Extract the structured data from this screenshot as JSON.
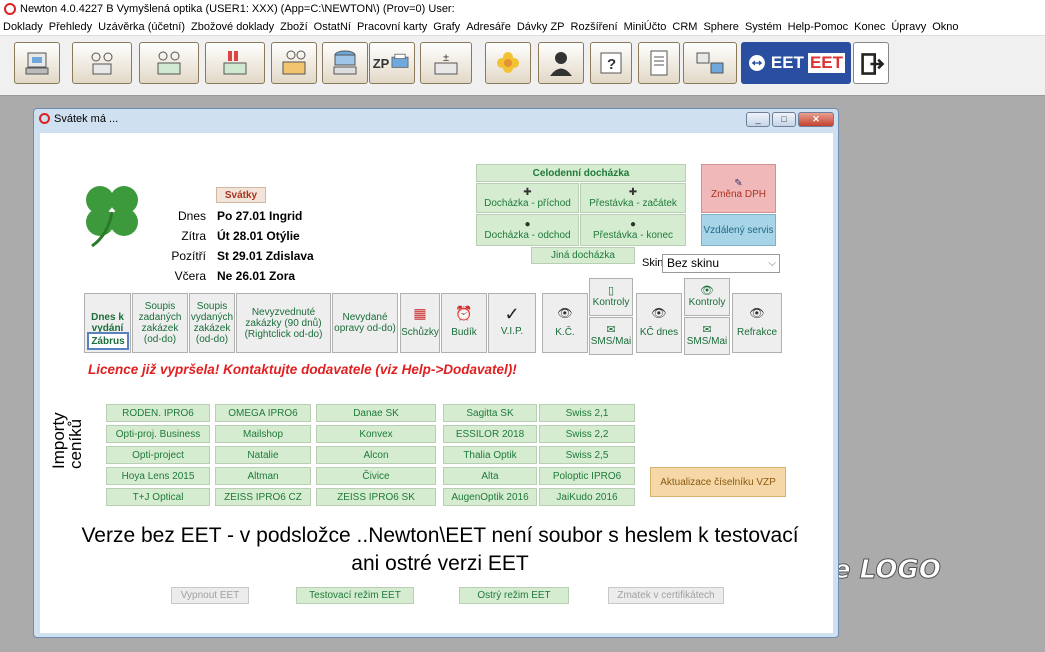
{
  "app": {
    "title": "Newton 4.0.4227 B Vymyšlená optika (USER1: XXX) (App=C:\\NEWTON\\) (Prov=0) User:"
  },
  "menu": [
    "Doklady",
    "Přehledy",
    "Uzávěrka (účetní)",
    "Zbožové doklady",
    "Zboží",
    "OstatNí",
    "Pracovní karty",
    "Grafy",
    "Adresáře",
    "Dávky ZP",
    "Rozšíření",
    "MiniÚčto",
    "CRM",
    "Sphere",
    "Systém",
    "Help-Pomoc",
    "Konec",
    "Úpravy",
    "Okno"
  ],
  "toolbar": {
    "zp_label": "ZP",
    "eet_label": "EET",
    "eet2_label": "EET"
  },
  "dialog": {
    "title": "Svátek má ...",
    "svatky_label": "Svátky",
    "rows": [
      {
        "label": "Dnes",
        "value": "Po 27.01 Ingrid"
      },
      {
        "label": "Zítra",
        "value": "Út 28.01 Otýlie"
      },
      {
        "label": "Pozítří",
        "value": "St 29.01 Zdislava"
      },
      {
        "label": "Včera",
        "value": "Ne 26.01 Zora"
      }
    ],
    "attendance": {
      "header": "Celodenní docházka",
      "prichod": "Docházka - příchod",
      "prestavka_zacatek": "Přestávka - začátek",
      "odchod": "Docházka - odchod",
      "prestavka_konec": "Přestávka - konec",
      "jina": "Jiná docházka"
    },
    "zmena_dph": "Změna DPH",
    "vzdaleny": "Vzdálený servis",
    "skin_label": "Skin",
    "skin_value": "Bez skinu",
    "tiles": {
      "dnes_k_vydani": "Dnes k vydání",
      "zabrus": "Zábrus",
      "soupis_zadanych": "Soupis zadaných zakázek (od-do)",
      "soupis_vydanych": "Soupis vydaných zakázek (od-do)",
      "nevyzvednute": "Nevyzvednuté zakázky (90 dnů) (Rightclick od-do)",
      "nevydane": "Nevydané opravy od-do)",
      "schuzky": "Schůzky",
      "budik": "Budík",
      "vip": "V.I.P.",
      "kc": "K.Č.",
      "kontroly1": "Kontroly",
      "sms1": "SMS/Mai",
      "kc_dnes": "KČ dnes",
      "kontroly2": "Kontroly",
      "sms2": "SMS/Mai",
      "refrakce": "Refrakce"
    },
    "licence_warning": "Licence již vypršela! Kontaktujte dodavatele (viz Help->Dodavatel)!",
    "imports_label": "Importy ceníků",
    "imports": [
      [
        "RODEN. IPRO6",
        "OMEGA IPRO6",
        "Danae SK",
        "Sagitta SK",
        "Swiss 2,1"
      ],
      [
        "Opti-proj. Business",
        "Mailshop",
        "Konvex",
        "ESSILOR 2018",
        "Swiss 2,2"
      ],
      [
        "Opti-project",
        "Natalie",
        "Alcon",
        "Thalia Optik",
        "Swiss 2,5"
      ],
      [
        "Hoya Lens 2015",
        "Altman",
        "Čivice",
        "Alta",
        "Poloptic IPRO6"
      ],
      [
        "T+J Optical",
        "ZEISS IPRO6 CZ",
        "ZEISS IPRO6 SK",
        "AugenOptik 2016",
        "JaiKudo 2016"
      ]
    ],
    "aktualizace": "Aktualizace číselníku VZP",
    "eet_message": "Verze bez EET - v podsložce ..Newton\\EET není soubor s heslem k testovací ani ostré verzi EET",
    "eet_buttons": {
      "vypnout": "Vypnout EET",
      "testovaci": "Testovací režim EET",
      "ostry": "Ostrý režim EET",
      "zmatek": "Zmatek v certifikátech"
    }
  },
  "background_logo": "e LOGO",
  "colors": {
    "green_button": "#d5ecd0",
    "green_text": "#1f7a3a",
    "warning_red": "#e02020",
    "dph_pink": "#f0b8b8",
    "servis_blue": "#a8d4e8",
    "aktualizace_orange": "#f6d7a8"
  }
}
